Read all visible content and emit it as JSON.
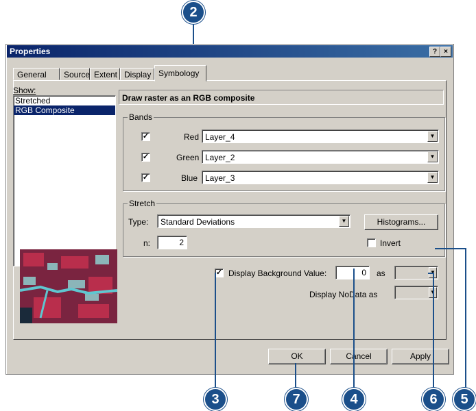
{
  "window": {
    "title": "Properties",
    "help_btn": "?",
    "close_btn": "×"
  },
  "tabs": [
    "General",
    "Source",
    "Extent",
    "Display",
    "Symbology"
  ],
  "show": {
    "label": "Show:",
    "items": [
      "Stretched",
      "RGB Composite"
    ],
    "selected": "RGB Composite"
  },
  "header": "Draw raster as an RGB composite",
  "bands": {
    "title": "Bands",
    "rows": [
      {
        "label": "Red",
        "value": "Layer_4",
        "checked": true
      },
      {
        "label": "Green",
        "value": "Layer_2",
        "checked": true
      },
      {
        "label": "Blue",
        "value": "Layer_3",
        "checked": true
      }
    ]
  },
  "stretch": {
    "title": "Stretch",
    "type_label": "Type:",
    "type_value": "Standard Deviations",
    "n_label": "n:",
    "n_value": "2",
    "histograms_button": "Histograms...",
    "invert_label": "Invert",
    "invert_checked": false
  },
  "background": {
    "label": "Display Background Value:",
    "checked": true,
    "value": "0",
    "as_label": "as",
    "nodata_label": "Display NoData as"
  },
  "buttons": {
    "ok": "OK",
    "cancel": "Cancel",
    "apply": "Apply"
  },
  "callouts": [
    "2",
    "3",
    "7",
    "4",
    "6",
    "5"
  ],
  "colors": {
    "callout": "#1b4f8a",
    "title_gradient_start": "#0a246a",
    "title_gradient_end": "#3a6ea5"
  }
}
